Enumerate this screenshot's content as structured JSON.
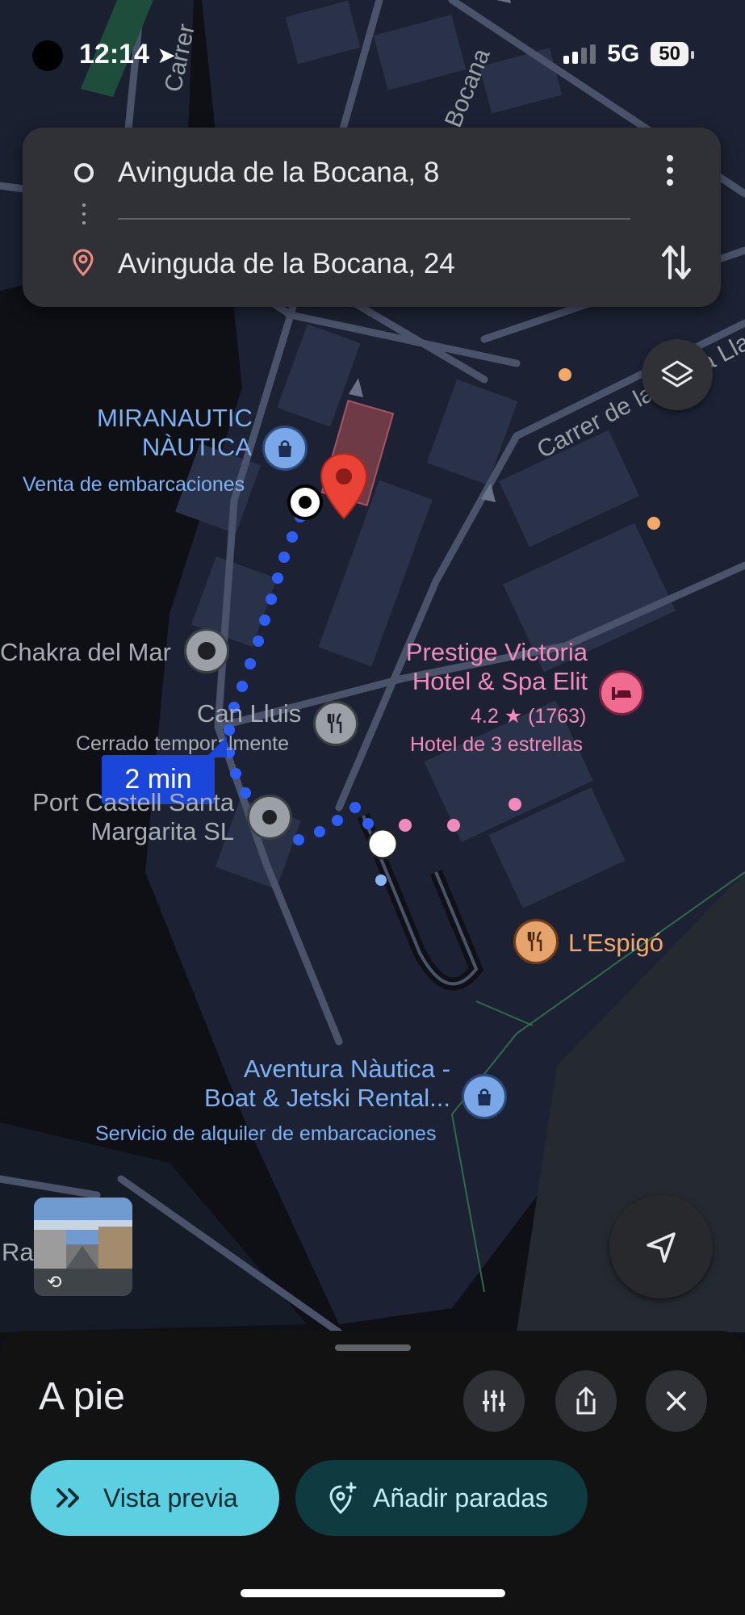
{
  "status_bar": {
    "time": "12:14",
    "network": "5G",
    "battery": "50"
  },
  "route": {
    "origin": "Avinguda de la Bocana, 8",
    "destination": "Avinguda de la Bocana, 24"
  },
  "streets": {
    "bocana": "Bocana",
    "carrer_top": "Carrer",
    "carrer_right": "Carrer de la Barca Llar"
  },
  "places": {
    "miranautic_line1": "MIRANAUTIC",
    "miranautic_line2": "NÀUTICA",
    "miranautic_category": "Venta de embarcaciones",
    "chakra": "Chakra del Mar",
    "prestige_line1": "Prestige Victoria",
    "prestige_line2": "Hotel & Spa Elit",
    "prestige_rating": "4.2",
    "prestige_reviews": "(1763)",
    "prestige_category": "Hotel de 3 estrellas",
    "canlluis_name": "Can Lluis",
    "canlluis_status": "Cerrado temporalmente",
    "port_line1": "Port Castell Santa",
    "port_line2": "Margarita SL",
    "espigo": "L'Espigó",
    "aventura_line1": "Aventura Nàutica -",
    "aventura_line2": "Boat & Jetski Rental...",
    "aventura_category": "Servicio de alquiler de embarcaciones",
    "cut_label": "Ra"
  },
  "route_time": "2 min",
  "icons": {
    "layers": "layers-icon",
    "locate": "navigation-arrow-icon",
    "tune": "tune-icon",
    "share": "share-icon",
    "close": "close-icon"
  },
  "bottom_sheet": {
    "mode": "A pie",
    "preview_button": "Vista previa",
    "add_stops_button": "Añadir paradas"
  },
  "colors": {
    "route_blue": "#2f5ef6",
    "destination_pin": "#ea4335",
    "preview_button": "#5ccfe0",
    "add_stops_button": "#0d3b3f"
  }
}
